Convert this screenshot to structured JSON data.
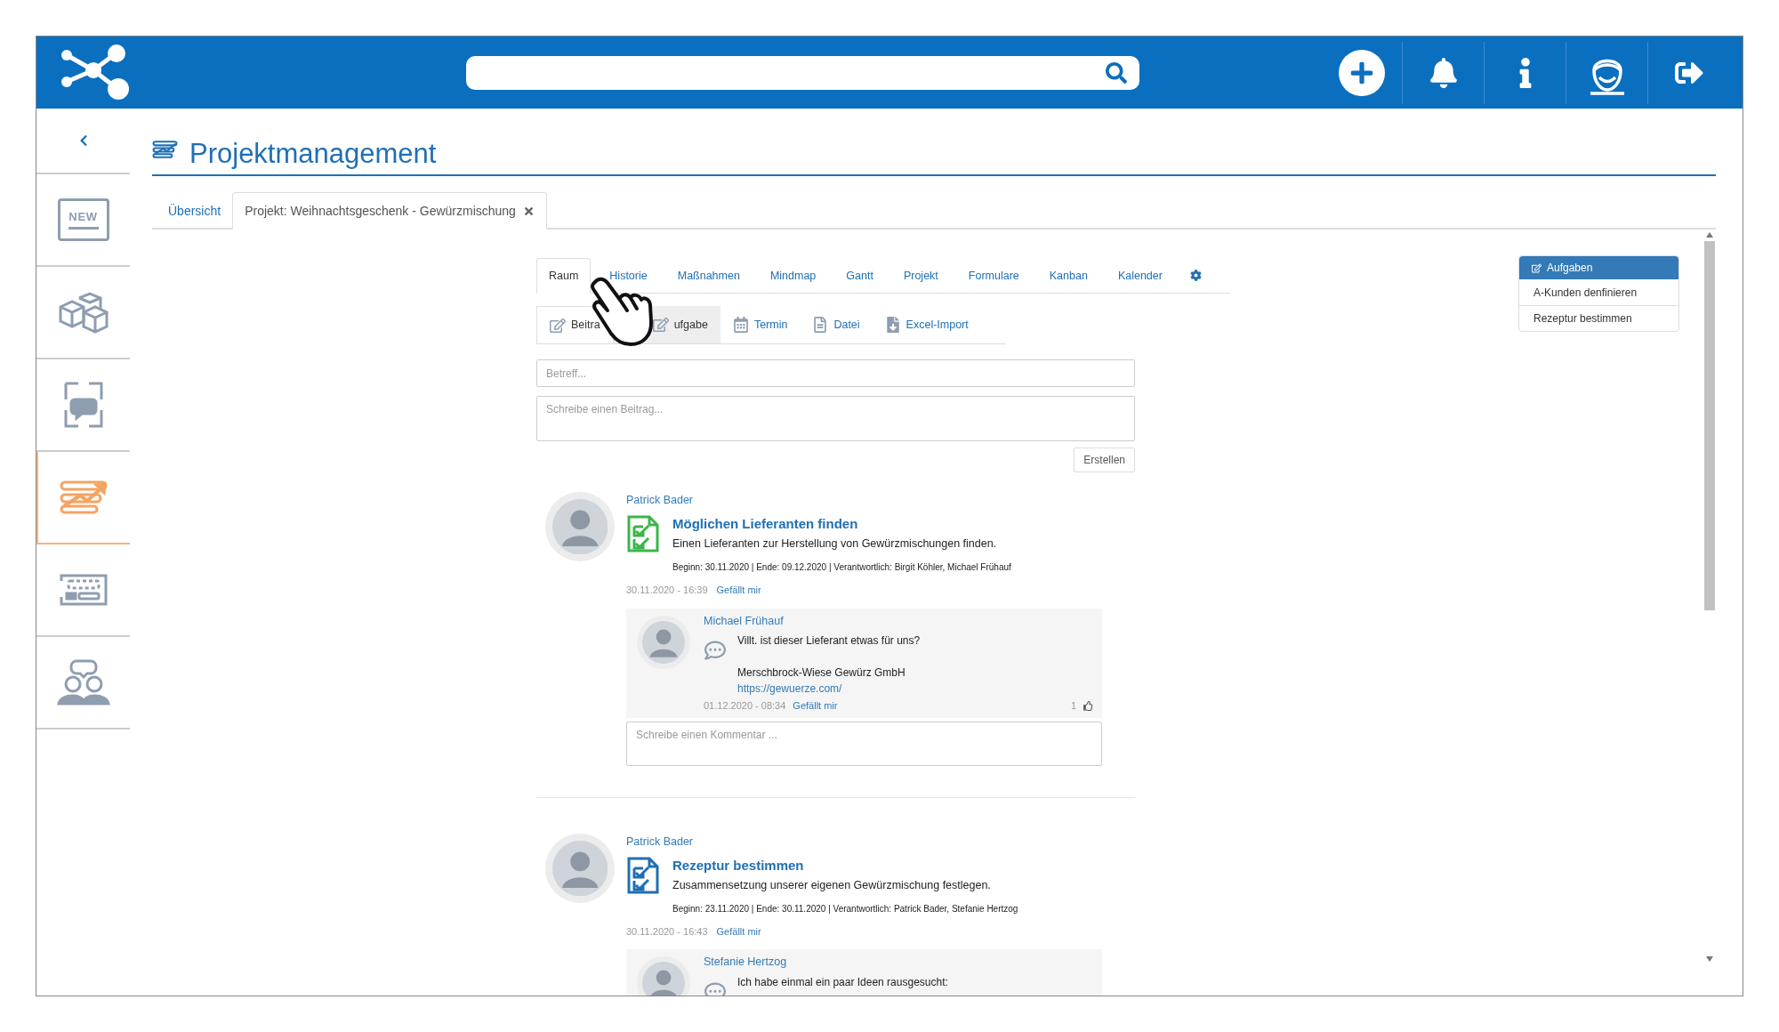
{
  "sidebar": {
    "items": [
      {
        "kind": "news",
        "selected": false,
        "badge": "NEW"
      },
      {
        "kind": "cubes",
        "selected": false
      },
      {
        "kind": "chat",
        "selected": false
      },
      {
        "kind": "project",
        "selected": true
      },
      {
        "kind": "board",
        "selected": false
      },
      {
        "kind": "people",
        "selected": false
      }
    ]
  },
  "page": {
    "title": "Projektmanagement"
  },
  "page_tabs": [
    {
      "label": "Übersicht",
      "selected": false,
      "closable": false
    },
    {
      "label": "Projekt: Weihnachtsgeschenk - Gewürzmischung",
      "selected": true,
      "closable": true
    }
  ],
  "room_tabs": [
    {
      "label": "Raum",
      "selected": true
    },
    {
      "label": "Historie",
      "selected": false
    },
    {
      "label": "Maßnahmen",
      "selected": false
    },
    {
      "label": "Mindmap",
      "selected": false
    },
    {
      "label": "Gantt",
      "selected": false
    },
    {
      "label": "Projekt",
      "selected": false
    },
    {
      "label": "Formulare",
      "selected": false
    },
    {
      "label": "Kanban",
      "selected": false
    },
    {
      "label": "Kalender",
      "selected": false
    }
  ],
  "post_types": [
    {
      "kind": "post",
      "label": "Beitra",
      "selected": false
    },
    {
      "kind": "task",
      "label": "ufgabe",
      "selected": true
    },
    {
      "kind": "date",
      "label": "Termin",
      "selected": false
    },
    {
      "kind": "file",
      "label": "Datei",
      "selected": false
    },
    {
      "kind": "import",
      "label": "Excel-Import",
      "selected": false
    }
  ],
  "composer": {
    "subject_placeholder": "Betreff...",
    "body_placeholder": "Schreibe einen Beitrag...",
    "submit": "Erstellen"
  },
  "posts": [
    {
      "author": "Patrick Bader",
      "done": true,
      "title": "Möglichen Lieferanten finden",
      "description": "Einen Lieferanten zur Herstellung von Gewürzmischungen finden.",
      "meta": "Beginn: 30.11.2020 | Ende: 09.12.2020 | Verantwortlich: Birgit Köhler, Michael Frühauf",
      "timestamp": "30.11.2020 - 16:39",
      "like": "Gefällt mir",
      "comments": [
        {
          "author": "Michael Frühauf",
          "lines": [
            {
              "kind": "text",
              "text": "Villt. ist dieser Lieferant etwas für uns?"
            },
            {
              "kind": "gap"
            },
            {
              "kind": "text",
              "text": "Merschbrock-Wiese Gewürz GmbH"
            },
            {
              "kind": "link",
              "text": "https://gewuerze.com/"
            }
          ],
          "timestamp": "01.12.2020 - 08:34",
          "like": "Gefällt mir",
          "like_count": "1"
        }
      ],
      "comment_placeholder": "Schreibe einen Kommentar ..."
    },
    {
      "author": "Patrick Bader",
      "done": false,
      "title": "Rezeptur bestimmen",
      "description": "Zusammensetzung unserer eigenen Gewürzmischung festlegen.",
      "meta": "Beginn: 23.11.2020 | Ende: 30.11.2020 | Verantwortlich: Patrick Bader, Stefanie Hertzog",
      "timestamp": "30.11.2020 - 16:43",
      "like": "Gefällt mir",
      "comments": [
        {
          "author": "Stefanie Hertzog",
          "lines": [
            {
              "kind": "text",
              "text": "Ich habe einmal ein paar Ideen rausgesucht:"
            }
          ]
        }
      ]
    }
  ],
  "side_panel": {
    "title": "Aufgaben",
    "items": [
      "A-Kunden denfinieren",
      "Rezeptur bestimmen"
    ]
  }
}
